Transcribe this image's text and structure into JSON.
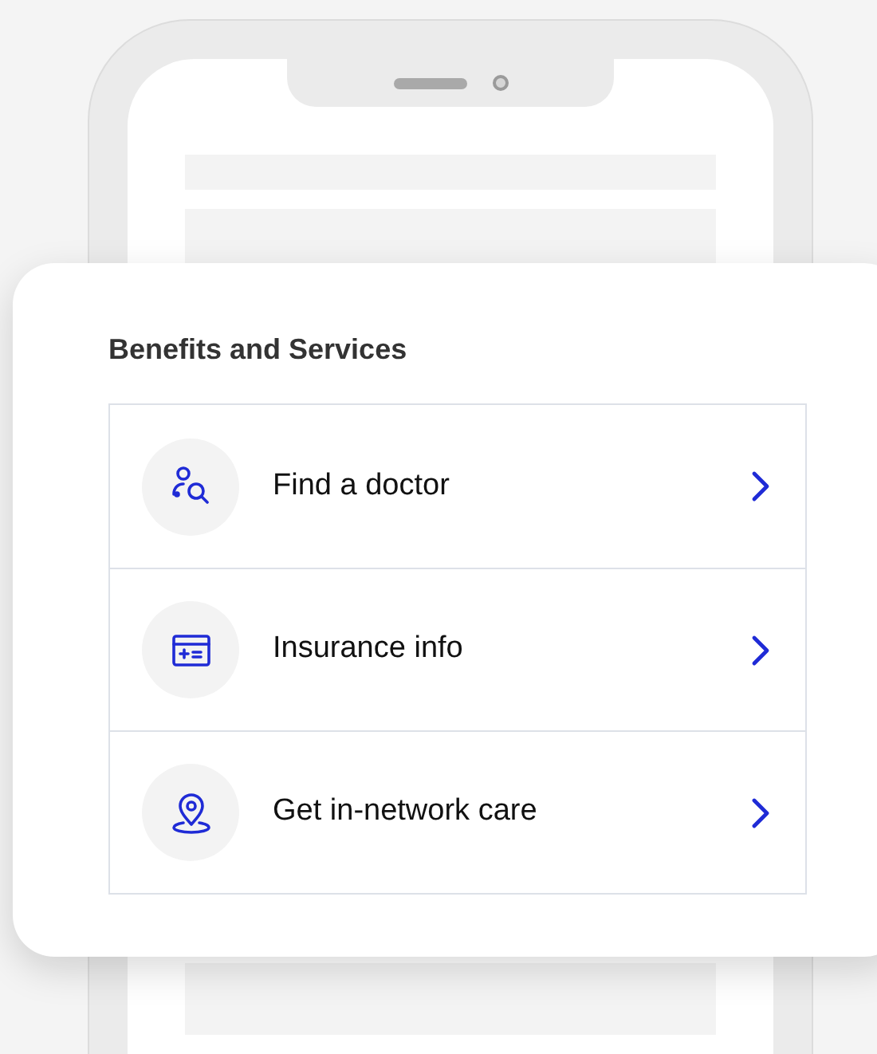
{
  "card": {
    "title": "Benefits and Services",
    "items": [
      {
        "kind": "doctor",
        "label": "Find a doctor"
      },
      {
        "kind": "insurance",
        "label": "Insurance info"
      },
      {
        "kind": "location",
        "label": "Get in-network care"
      }
    ]
  }
}
